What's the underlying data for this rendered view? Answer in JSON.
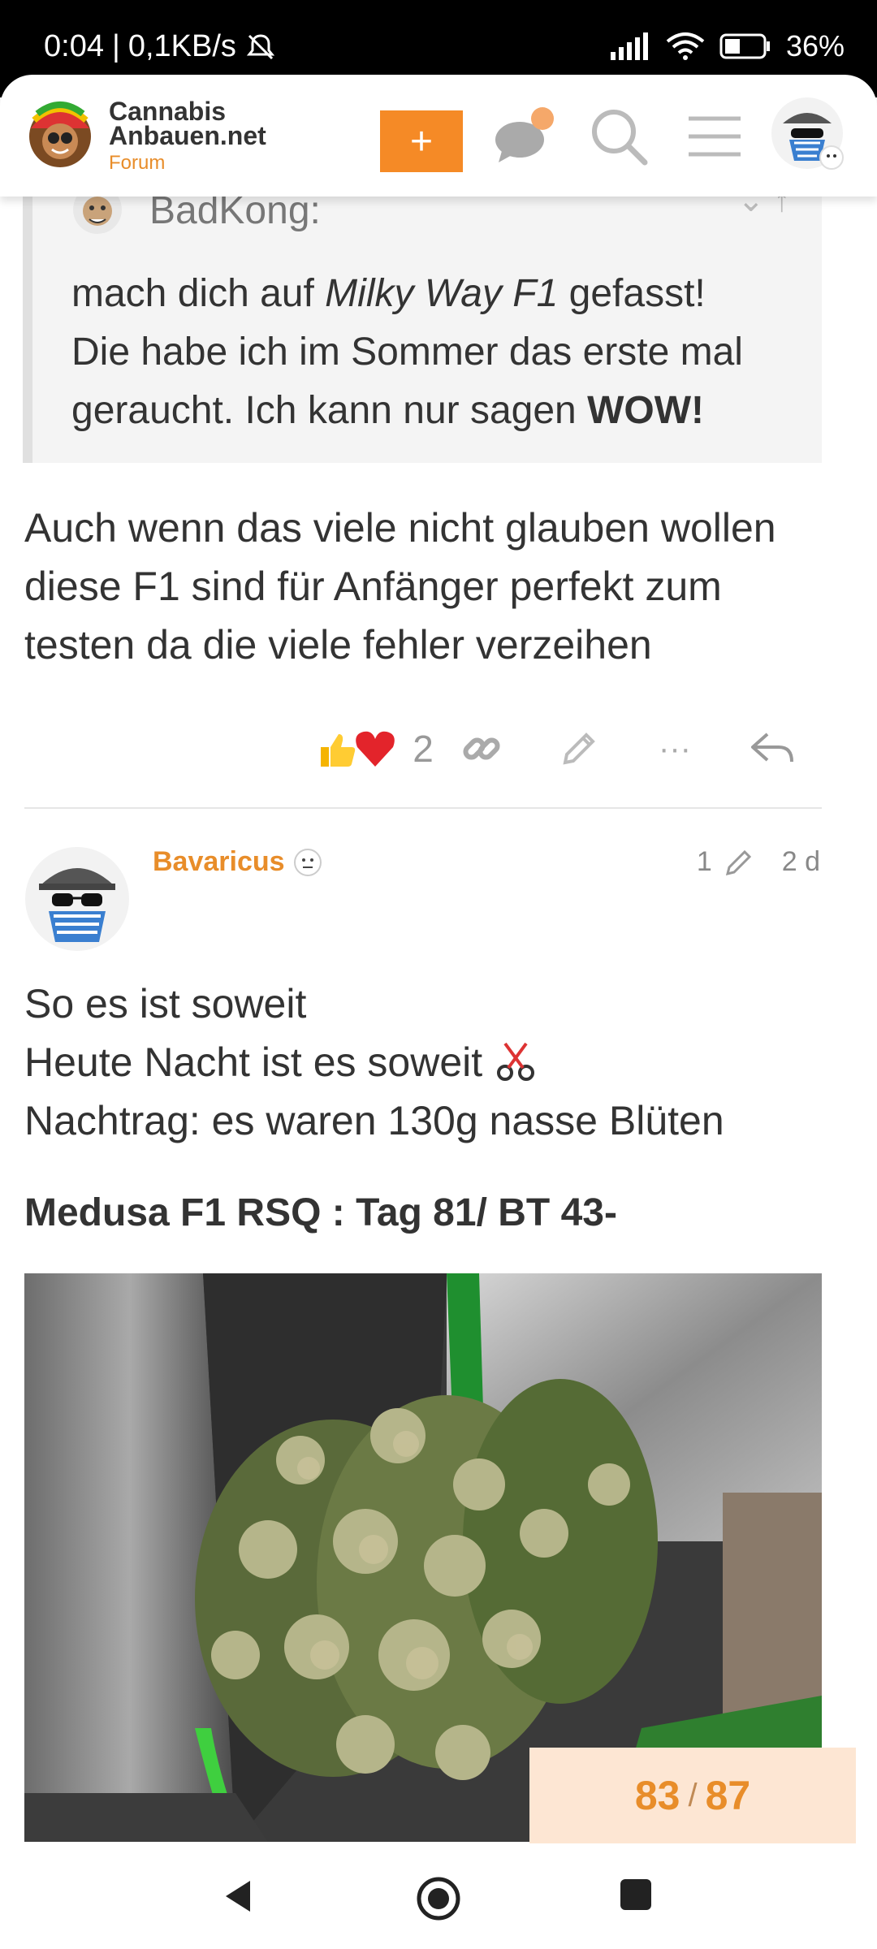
{
  "status": {
    "time": "0:04",
    "net_speed": "0,1KB/s",
    "battery": "36%"
  },
  "header": {
    "logo_name_line1": "Cannabis",
    "logo_name_line2": "Anbauen.net",
    "logo_sub": "Forum",
    "plus_label": "+",
    "icons": [
      "chat-icon",
      "search-icon",
      "menu-icon",
      "user-avatar"
    ],
    "accent": "#f58a26"
  },
  "quote": {
    "author": "BadKong:",
    "line1_a": "mach dich auf ",
    "line1_em": "Milky Way F1",
    "line1_b": " gefasst!",
    "line2": "Die habe ich im Sommer das erste mal",
    "line3_a": "geraucht. Ich kann nur sagen ",
    "line3_b": "WOW!"
  },
  "post1": {
    "line1": "Auch wenn das viele nicht glauben wollen",
    "line2": "diese F1 sind für Anfänger perfekt zum",
    "line3": "testen da die viele fehler verzeihen",
    "reaction_count": "2",
    "more": "···"
  },
  "post2": {
    "username": "Bavaricus",
    "edit_count": "1",
    "age": "2 d",
    "line1": "So es ist soweit",
    "line2": "Heute Nacht ist es soweit",
    "line3": "Nachtrag: es waren 130g nasse Blüten",
    "heading": "Medusa F1 RSQ : Tag 81/ BT 43-"
  },
  "progress": {
    "current": "83",
    "separator": "/",
    "total": "87"
  }
}
